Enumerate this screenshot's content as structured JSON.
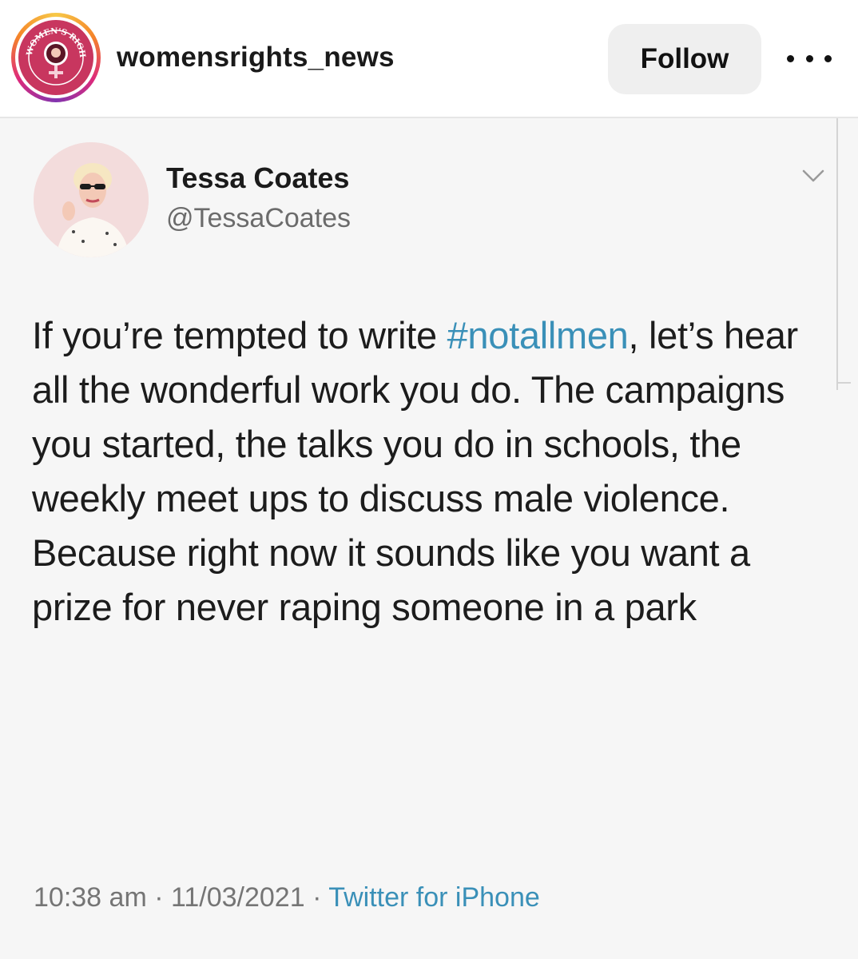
{
  "post_header": {
    "username": "womensrights_news",
    "avatar_icon": "womens-rights-news-logo-icon",
    "avatar_badge_text": "WOMEN'S RIGHTS NEWS",
    "follow_label": "Follow",
    "more_icon": "more-options-icon"
  },
  "tweet": {
    "author_name": "Tessa Coates",
    "author_handle": "@TessaCoates",
    "text_before_hashtag": "If you’re tempted to write ",
    "hashtag": "#notallmen",
    "text_after_hashtag": ", let’s hear all the wonderful work you do. The campaigns you started, the talks you do in schools, the weekly meet ups to discuss male violence. Because right now it sounds like you want a prize for never raping someone in a park",
    "timestamp": "10:38 am · 11/03/2021 · ",
    "source": "Twitter for iPhone",
    "chevron_icon": "chevron-down-icon"
  },
  "colors": {
    "link": "#3a90b8",
    "logo_pink": "#c8365f",
    "follow_bg": "#efefef"
  }
}
